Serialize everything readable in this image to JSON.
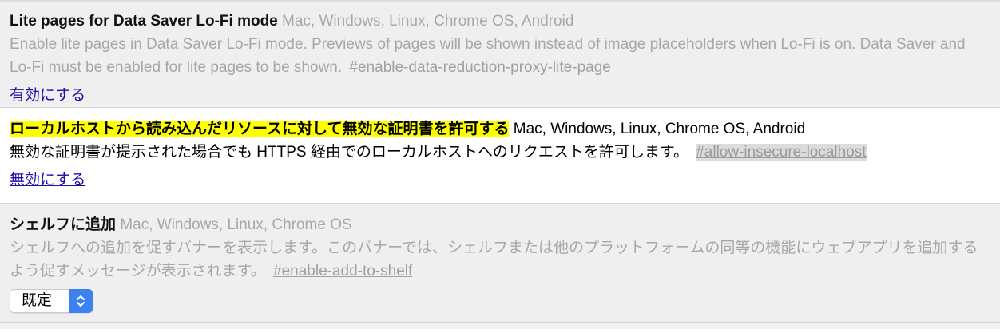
{
  "experiments": [
    {
      "name": "Lite pages for Data Saver Lo-Fi mode",
      "platforms": "Mac, Windows, Linux, Chrome OS, Android",
      "description": "Enable lite pages in Data Saver Lo-Fi mode. Previews of pages will be shown instead of image placeholders when Lo-Fi is on. Data Saver and Lo-Fi must be enabled for lite pages to be shown.",
      "permalink": "#enable-data-reduction-proxy-lite-page",
      "action_label": "有効にする"
    },
    {
      "name": "ローカルホストから読み込んだリソースに対して無効な証明書を許可する",
      "platforms": "Mac, Windows, Linux, Chrome OS, Android",
      "description": "無効な証明書が提示された場合でも HTTPS 経由でのローカルホストへのリクエストを許可します。",
      "permalink": "#allow-insecure-localhost",
      "action_label": "無効にする"
    },
    {
      "name": "シェルフに追加",
      "platforms": "Mac, Windows, Linux, Chrome OS",
      "description": "シェルフへの追加を促すバナーを表示します。このバナーでは、シェルフまたは他のプラットフォームの同等の機能にウェブアプリを追加するよう促すメッセージが表示されます。",
      "permalink": "#enable-add-to-shelf",
      "select_value": "既定"
    }
  ],
  "colors": {
    "highlight": "#ffff00",
    "link": "#1a0dab",
    "select_arrow_bg": "#3b82f0"
  },
  "icons": {
    "select_arrows": "updown-chevron-icon"
  }
}
